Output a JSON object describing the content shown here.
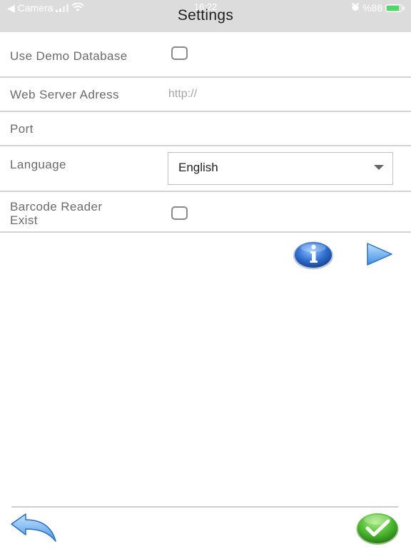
{
  "status_bar": {
    "back_app": "◀ Camera",
    "time": "16:22",
    "battery_text": "%88",
    "battery_level": 0.88
  },
  "header": {
    "title": "Settings"
  },
  "settings": {
    "use_demo_database": {
      "label": "Use Demo Database",
      "checked": false
    },
    "web_server": {
      "label": "Web Server Adress",
      "placeholder": "http://",
      "value": ""
    },
    "port": {
      "label": "Port",
      "value": ""
    },
    "language": {
      "label": "Language",
      "selected": "English"
    },
    "barcode_reader": {
      "label_line1": "Barcode Reader",
      "label_line2": "Exist",
      "checked": false
    }
  },
  "colors": {
    "header_bg": "#dcdcdc",
    "divider": "#d4d4d4",
    "info_blue": "#2f6fd0",
    "next_blue": "#5aa8f0",
    "confirm_green": "#4bb82f"
  },
  "icons": {
    "info": "info-icon",
    "next": "play-arrow-icon",
    "back": "back-arrow-icon",
    "confirm": "checkmark-icon"
  }
}
